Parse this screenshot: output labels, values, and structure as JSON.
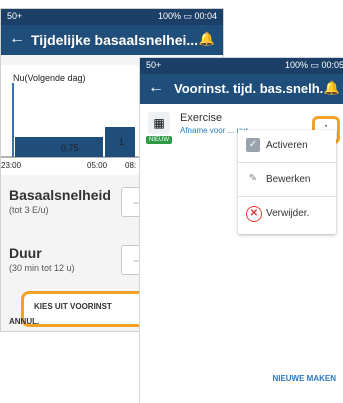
{
  "back_screen": {
    "status": {
      "left": "50+",
      "right": "100% ▭ 00:04"
    },
    "header": {
      "title": "Tijdelijke basaalsnelhei..."
    },
    "chart": {
      "label": "Nu(Volgende dag)",
      "bar_values": [
        "0,75",
        "1"
      ],
      "ticks": [
        "23:00",
        "05:00",
        "08:"
      ]
    },
    "basal": {
      "label": "Basaalsnelheid",
      "sub": "(tot 3 E/u)",
      "box": "– –"
    },
    "duration": {
      "label": "Duur",
      "sub": "(30 min tot 12 u)",
      "box": "– –"
    },
    "kies_button": "KIES UIT VOORINST",
    "annul": "ANNUL."
  },
  "front_screen": {
    "status": {
      "left": "50+",
      "right": "100% ▭ 00:05"
    },
    "header": {
      "title": "Voorinst. tijd. bas.snelh."
    },
    "item": {
      "name": "Exercise",
      "desc": "Afname voor ... uur",
      "badge": "NIEUW"
    },
    "menu": {
      "items": [
        {
          "label": "Activeren"
        },
        {
          "label": "Bewerken"
        },
        {
          "label": "Verwijder."
        }
      ]
    },
    "nieuwe_button": "NIEUWE MAKEN"
  },
  "colors": {
    "header_blue": "#1f4e7a",
    "status_blue": "#1b3f66",
    "highlight_orange": "#f2a224",
    "link_blue": "#2a79c2",
    "badge_green": "#2e9a44",
    "delete_red": "#e53935"
  }
}
